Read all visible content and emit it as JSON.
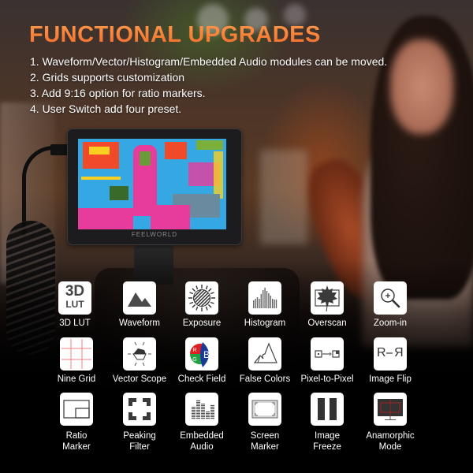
{
  "title": "FUNCTIONAL UPGRADES",
  "features": [
    "1. Waveform/Vector/Histogram/Embedded Audio modules can be moved.",
    "2. Grids supports customization",
    "3. Add 9:16 option for ratio markers.",
    "4. User Switch add four preset."
  ],
  "monitor": {
    "brand": "FEELWORLD"
  },
  "colors": {
    "title_gradient_top": "#ff9a4a",
    "title_gradient_bottom": "#f06a2a",
    "icon_bg": "#ffffff",
    "icon_fg": "#4a4a4a",
    "grid_red": "#f08080",
    "rgb_red": "#e02020",
    "rgb_green": "#20a040",
    "rgb_blue": "#1a3a9a"
  },
  "functions": {
    "row1": [
      {
        "label": "3D LUT",
        "icon": "3d-lut-icon",
        "glyph_top": "3D",
        "glyph_bottom": "LUT"
      },
      {
        "label": "Waveform",
        "icon": "waveform-icon"
      },
      {
        "label": "Exposure",
        "icon": "exposure-icon"
      },
      {
        "label": "Histogram",
        "icon": "histogram-icon"
      },
      {
        "label": "Overscan",
        "icon": "overscan-icon"
      },
      {
        "label": "Zoom-in",
        "icon": "zoom-in-icon"
      }
    ],
    "row2": [
      {
        "label": "Nine Grid",
        "icon": "nine-grid-icon"
      },
      {
        "label": "Vector Scope",
        "icon": "vector-scope-icon"
      },
      {
        "label": "Check Field",
        "icon": "check-field-icon",
        "glyph_r": "R",
        "glyph_g": "G",
        "glyph_b": "B"
      },
      {
        "label": "False Colors",
        "icon": "false-colors-icon"
      },
      {
        "label": "Pixel-to-Pixel",
        "icon": "pixel-to-pixel-icon"
      },
      {
        "label": "Image Flip",
        "icon": "image-flip-icon",
        "glyph": "R-R"
      }
    ],
    "row3": [
      {
        "label_line1": "Ratio",
        "label_line2": "Marker",
        "icon": "ratio-marker-icon"
      },
      {
        "label_line1": "Peaking",
        "label_line2": "Filter",
        "icon": "peaking-filter-icon"
      },
      {
        "label_line1": "Embedded",
        "label_line2": "Audio",
        "icon": "embedded-audio-icon"
      },
      {
        "label_line1": "Screen",
        "label_line2": "Marker",
        "icon": "screen-marker-icon"
      },
      {
        "label_line1": "Image",
        "label_line2": "Freeze",
        "icon": "image-freeze-icon"
      },
      {
        "label_line1": "Anamorphic",
        "label_line2": "Mode",
        "icon": "anamorphic-mode-icon"
      }
    ]
  }
}
